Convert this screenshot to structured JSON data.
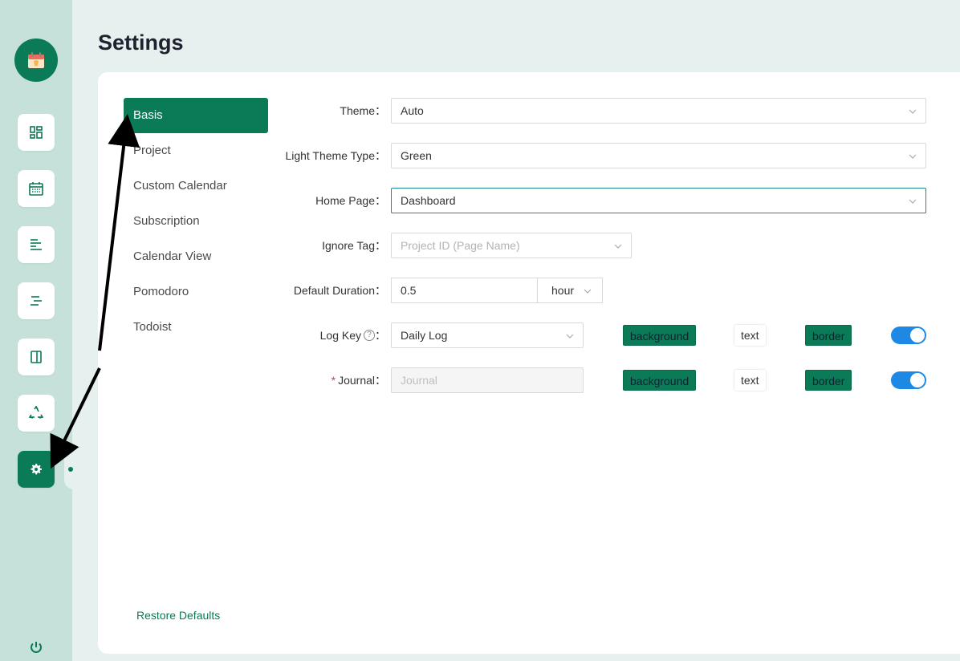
{
  "page_title": "Settings",
  "sidebar": {
    "logo_icon": "calendar-app-logo-icon",
    "items": [
      {
        "name": "dashboard",
        "icon": "dashboard-icon",
        "active": false
      },
      {
        "name": "calendar",
        "icon": "calendar-icon",
        "active": false
      },
      {
        "name": "gantt",
        "icon": "gantt-icon",
        "active": false
      },
      {
        "name": "timeline",
        "icon": "timeline-icon",
        "active": false
      },
      {
        "name": "board",
        "icon": "board-icon",
        "active": false
      },
      {
        "name": "recycle",
        "icon": "recycle-icon",
        "active": false
      },
      {
        "name": "settings",
        "icon": "gear-icon",
        "active": true
      }
    ],
    "power_icon": "power-icon"
  },
  "menu": {
    "items": [
      "Basis",
      "Project",
      "Custom Calendar",
      "Subscription",
      "Calendar View",
      "Pomodoro",
      "Todoist"
    ],
    "active": "Basis",
    "restore_label": "Restore Defaults"
  },
  "form": {
    "theme": {
      "label": "Theme",
      "value": "Auto"
    },
    "light_theme_type": {
      "label": "Light Theme Type",
      "value": "Green"
    },
    "home_page": {
      "label": "Home Page",
      "value": "Dashboard"
    },
    "ignore_tag": {
      "label": "Ignore Tag",
      "placeholder": "Project ID (Page Name)"
    },
    "default_duration": {
      "label": "Default Duration",
      "value": "0.5",
      "unit": "hour"
    },
    "log_key": {
      "label": "Log Key",
      "value": "Daily Log",
      "background_label": "background",
      "text_label": "text",
      "border_label": "border",
      "enabled": true
    },
    "journal": {
      "label": "Journal",
      "required_mark": "*",
      "placeholder": "Journal",
      "background_label": "background",
      "text_label": "text",
      "border_label": "border",
      "enabled": true
    },
    "label_colon": "："
  },
  "colors": {
    "accent": "#0a7a57",
    "toggle_on": "#1e88e5",
    "sidebar_bg": "#c5e1d9",
    "page_bg": "#e6f0ee"
  }
}
